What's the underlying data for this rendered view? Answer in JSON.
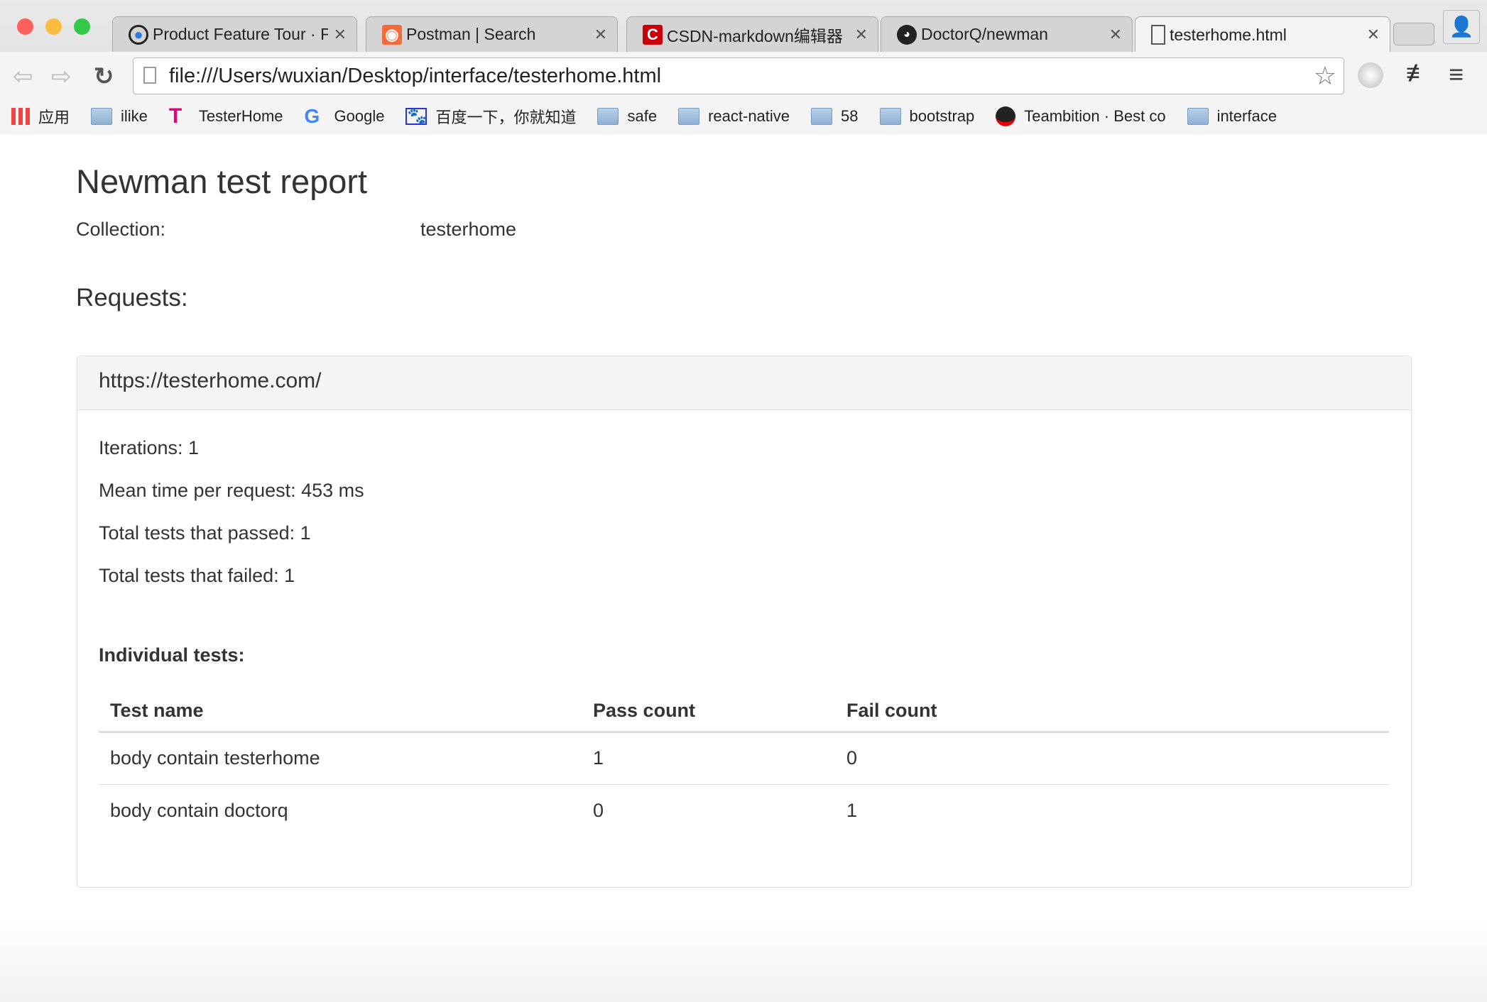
{
  "browser": {
    "tabs": [
      {
        "label": "Product Feature Tour · F",
        "icon": "gear-icon"
      },
      {
        "label": "Postman | Search",
        "icon": "postman-icon"
      },
      {
        "label": "CSDN-markdown编辑器",
        "icon": "csdn-icon"
      },
      {
        "label": "DoctorQ/newman",
        "icon": "github-icon"
      },
      {
        "label": "testerhome.html",
        "icon": "file-icon",
        "active": true
      }
    ],
    "url": "file:///Users/wuxian/Desktop/interface/testerhome.html",
    "bookmarks": [
      {
        "label": "应用",
        "icon": "apps-icon"
      },
      {
        "label": "ilike",
        "icon": "folder-icon"
      },
      {
        "label": "TesterHome",
        "icon": "testerhome-icon"
      },
      {
        "label": "Google",
        "icon": "google-icon"
      },
      {
        "label": "百度一下，你就知道",
        "icon": "baidu-icon"
      },
      {
        "label": "safe",
        "icon": "folder-icon"
      },
      {
        "label": "react-native",
        "icon": "folder-icon"
      },
      {
        "label": "58",
        "icon": "folder-icon"
      },
      {
        "label": "bootstrap",
        "icon": "folder-icon"
      },
      {
        "label": "Teambition · Best co",
        "icon": "teambition-icon"
      },
      {
        "label": "interface",
        "icon": "folder-icon"
      }
    ]
  },
  "report": {
    "title": "Newman test report",
    "collection_label": "Collection:",
    "collection_value": "testerhome",
    "requests_heading": "Requests:",
    "request": {
      "url": "https://testerhome.com/",
      "stats": [
        "Iterations: 1",
        "Mean time per request: 453 ms",
        "Total tests that passed: 1",
        "Total tests that failed: 1"
      ],
      "individual_heading": "Individual tests:",
      "columns": [
        "Test name",
        "Pass count",
        "Fail count"
      ],
      "rows": [
        [
          "body contain testerhome",
          "1",
          "0"
        ],
        [
          "body contain doctorq",
          "0",
          "1"
        ]
      ]
    }
  }
}
